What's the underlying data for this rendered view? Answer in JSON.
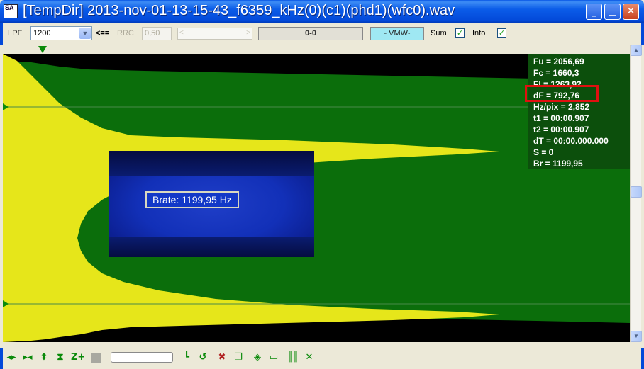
{
  "window": {
    "app_icon": "SA",
    "title": "[TempDir] 2013-nov-01-13-15-43_f6359_kHz(0)(c1)(phd1)(wfc0).wav",
    "minimize_icon": "_",
    "maximize_icon": "□",
    "close_icon": "✕"
  },
  "toolbar": {
    "lpf_label": "LPF",
    "lpf_value": "1200",
    "arrow_label": "<==",
    "rrc_label": "RRC",
    "rrc_value": "0,50",
    "slider_left": "<",
    "slider_right": ">",
    "position_readout": "0-0",
    "mode_label": "- VMW-",
    "sum_label": "Sum",
    "sum_checked": "✓",
    "info_label": "Info",
    "info_checked": "✓"
  },
  "info": {
    "fu": "Fu = 2056,69",
    "fc": "Fc = 1660,3",
    "fl": "Fl = 1263,92",
    "df": "dF = 792,76",
    "hzpix": "Hz/pix = 2,852",
    "t1": "t1 = 00:00.907",
    "t2": "t2 = 00:00.907",
    "dt": "dT = 00:00.000.000",
    "s": "S = 0",
    "br": "Br = 1199,95"
  },
  "brate_label": "Brate: 1199,95 Hz",
  "colors": {
    "spectrum_green": "#0b6e0b",
    "envelope_yellow": "#e6e61a",
    "highlight_red": "#e01010",
    "info_bg": "#0c4f0c"
  },
  "bottom_toolbar": {
    "icons": [
      "pan-left-right-icon",
      "zoom-in-out-icon",
      "pan-up-down-icon",
      "zoom-x-icon",
      "zoom-plus-icon",
      "stop-icon",
      "cursor-icon",
      "loop-icon",
      "delete-marker-icon",
      "copy-icon",
      "center-icon",
      "fit-icon",
      "bars-icon",
      "cross-icon"
    ]
  }
}
